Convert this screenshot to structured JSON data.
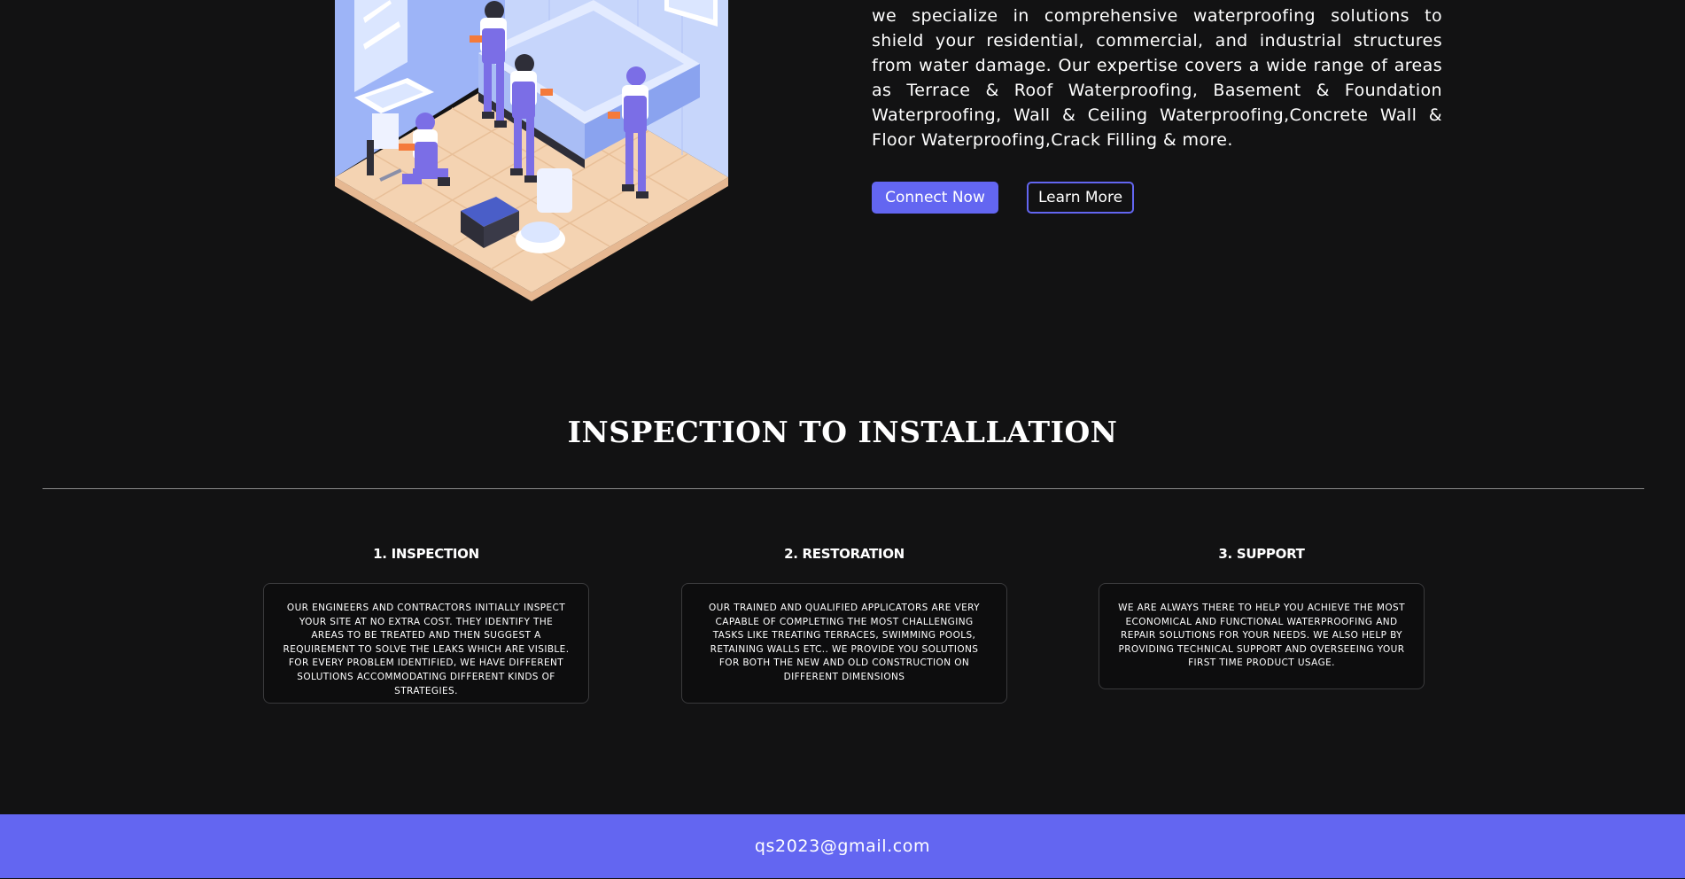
{
  "hero": {
    "description": "we specialize in comprehensive waterproofing solutions to shield your residential, commercial, and industrial structures from water damage. Our expertise covers a wide range of areas as Terrace & Roof Waterproofing, Basement & Foundation Waterproofing, Wall & Ceiling Waterproofing,Concrete Wall & Floor Waterproofing,Crack Filling & more.",
    "primary_button": "Connect Now",
    "secondary_button": "Learn More",
    "illustration_icon": "workers-installing-bathtub-illustration"
  },
  "section": {
    "title": "INSPECTION TO INSTALLATION",
    "steps": [
      {
        "title": "1. INSPECTION",
        "text": "Our engineers and contractors initially inspect your site at no extra cost. They identify the areas to be treated and then suggest a requirement to solve the leaks which are visible. For every problem identified, we have different solutions accommodating different kinds of strategies."
      },
      {
        "title": "2. RESTORATION",
        "text": "Our trained and qualified applicators are very capable of completing the most challenging tasks like treating terraces, swimming pools, retaining walls etc.. We provide you solutions for both the new and old construction on different dimensions"
      },
      {
        "title": "3. SUPPORT",
        "text": "We are always there to help you achieve the most economical and functional waterproofing and repair solutions for your needs. We also help by providing technical support and overseeing your first time product usage."
      }
    ]
  },
  "footer": {
    "email": "qs2023@gmail.com"
  },
  "colors": {
    "background": "#121213",
    "accent": "#6366f1",
    "text": "#ffffff"
  }
}
